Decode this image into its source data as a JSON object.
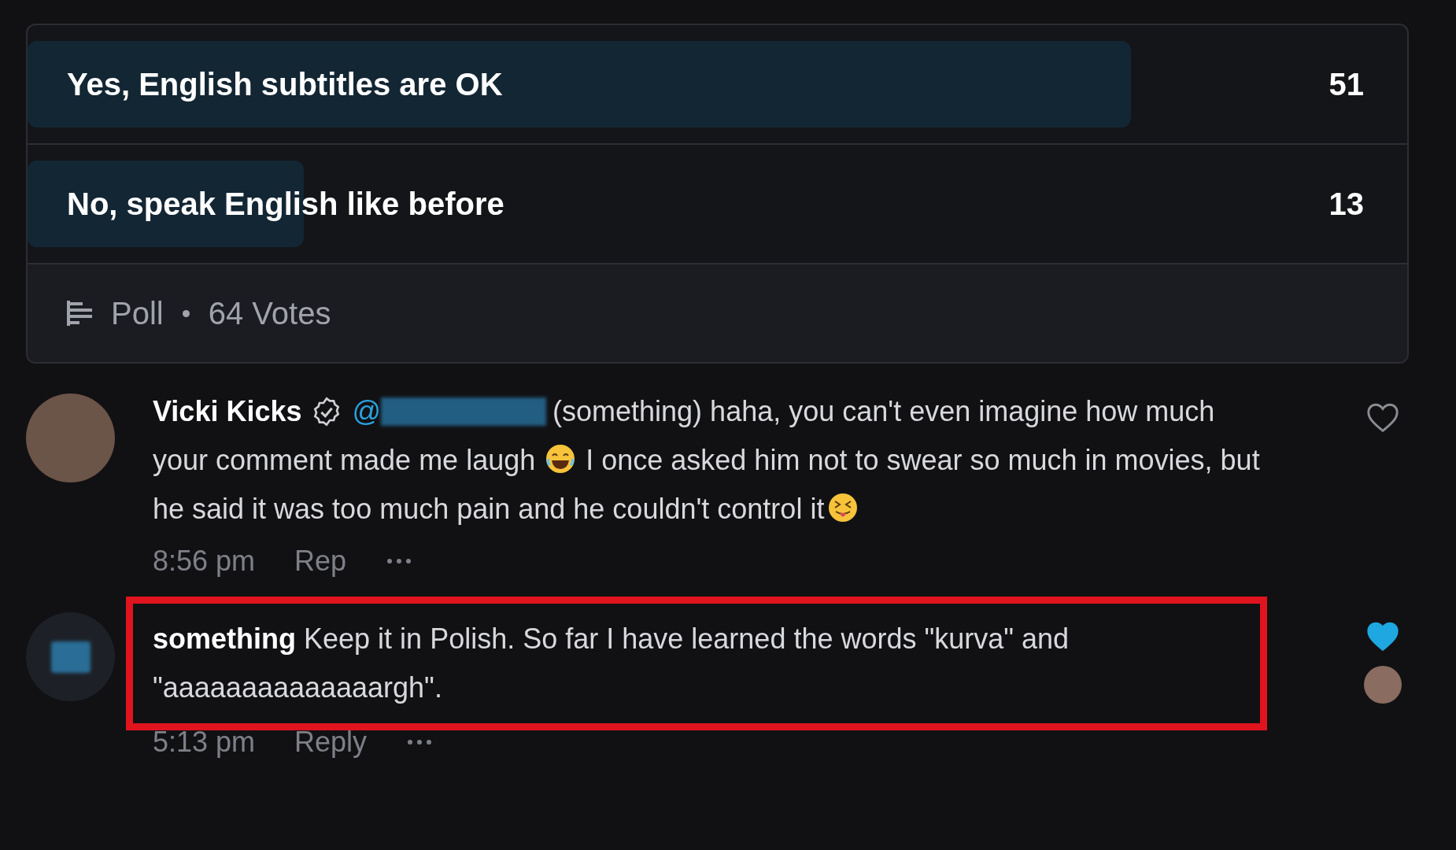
{
  "poll": {
    "options": [
      {
        "label": "Yes, English subtitles are OK",
        "count": "51",
        "level": 0.8
      },
      {
        "label": "No, speak English like before",
        "count": "13",
        "level": 0.2
      }
    ],
    "footer": {
      "label": "Poll",
      "votes": "64 Votes"
    }
  },
  "comments": [
    {
      "author": "Vicki Kicks",
      "verified": true,
      "mention": "@",
      "segments": [
        {
          "kind": "text",
          "text": "(something) haha, you can't even imagine how much your comment made me laugh"
        },
        {
          "kind": "laugh_emoji"
        },
        {
          "kind": "text",
          "text": "I once asked him not to swear so much in movies, but he said it was too much pain and he couldn't control it"
        },
        {
          "kind": "tongue_emoji"
        }
      ],
      "time": "8:56 pm",
      "reply": "Rep",
      "liked": false,
      "highlighted": false,
      "liked_by_author": false
    },
    {
      "author": "something",
      "verified": false,
      "segments": [
        {
          "kind": "text",
          "text": "Keep it in Polish. So far I have learned the words \"kurva\" and \"aaaaaaaaaaaaaargh\"."
        }
      ],
      "time": "5:13 pm",
      "reply": "Reply",
      "liked": true,
      "highlighted": true,
      "liked_by_author": true
    }
  ]
}
